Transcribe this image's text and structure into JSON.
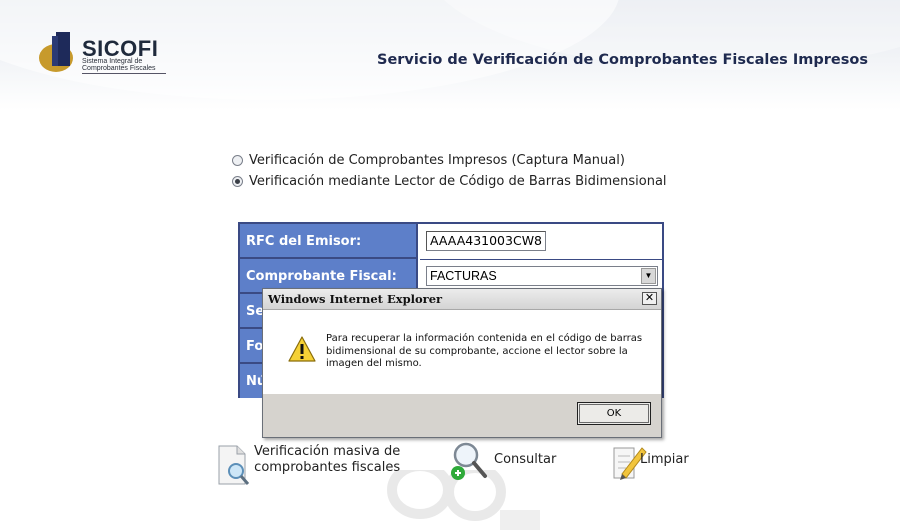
{
  "header": {
    "logo_name": "SICOFI",
    "logo_subtitle_1": "Sistema Integral de",
    "logo_subtitle_2": "Comprobantes Fiscales",
    "title": "Servicio de Verificación de Comprobantes Fiscales Impresos"
  },
  "mode": {
    "options": [
      {
        "label": "Verificación de Comprobantes Impresos (Captura Manual)",
        "checked": false
      },
      {
        "label": "Verificación mediante Lector de Código de Barras Bidimensional",
        "checked": true
      }
    ]
  },
  "form": {
    "rfc_label": "RFC del Emisor:",
    "rfc_value": "AAAA431003CW8",
    "comprobante_label": "Comprobante Fiscal:",
    "comprobante_value": "FACTURAS",
    "row3_label": "Se",
    "row4_label": "Fo",
    "row5_label": "Nú"
  },
  "actions": {
    "masiva_line1": "Verificación masiva de",
    "masiva_line2": "comprobantes fiscales",
    "consultar": "Consultar",
    "limpiar": "Limpiar"
  },
  "dialog": {
    "title": "Windows Internet Explorer",
    "close_glyph": "✕",
    "message_line1": "Para recuperar la información contenida en el código de barras",
    "message_line2": "bidimensional de su comprobante, accione el lector sobre la",
    "message_line3": "imagen del mismo.",
    "ok_label": "OK"
  },
  "colors": {
    "form_label_bg": "#5d7fc9",
    "form_border": "#3a4a84",
    "title_color": "#1f2a4f"
  },
  "icons": [
    "sicofi-logo-icon",
    "warning-icon",
    "document-search-icon",
    "magnifier-add-icon",
    "pencil-note-icon"
  ]
}
